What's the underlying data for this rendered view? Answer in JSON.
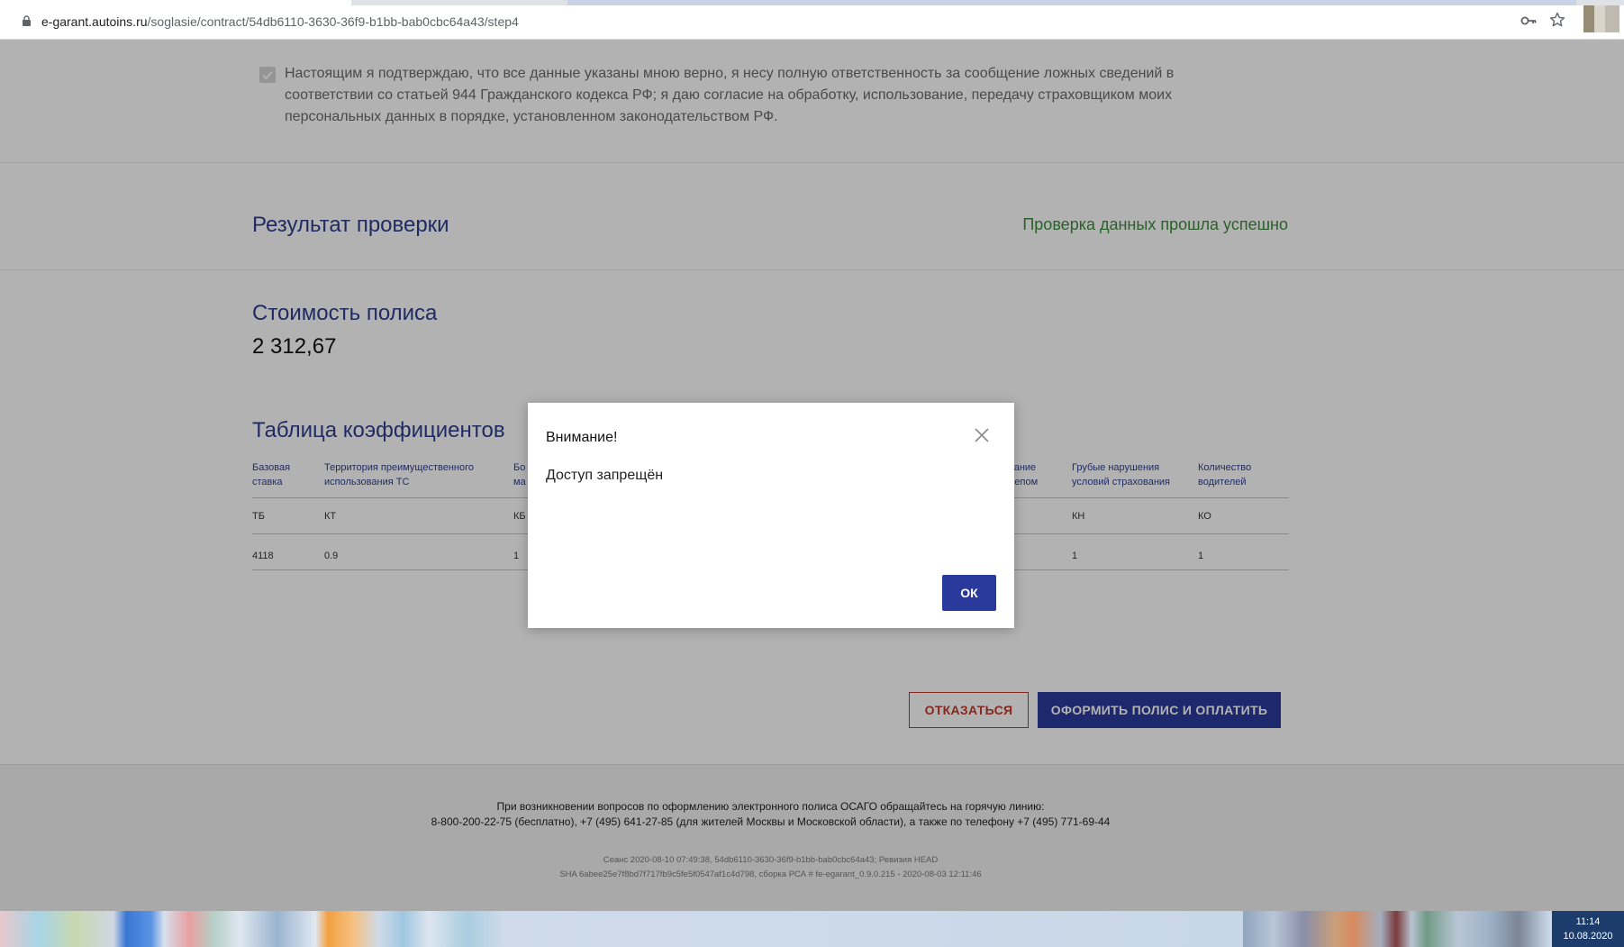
{
  "browser": {
    "url_host": "e-garant.autoins.ru",
    "url_path": "/soglasie/contract/54db6110-3630-36f9-b1bb-bab0cbc64a43/step4",
    "icons": [
      "lock-icon",
      "key-icon",
      "star-icon"
    ]
  },
  "consent": {
    "checked": true,
    "text": "Настоящим я подтверждаю, что все данные указаны мною верно, я несу полную ответственность за сообщение ложных сведений в соответствии со статьей 944 Гражданского кодекса РФ; я даю согласие на обработку, использование, передачу страховщиком моих персональных данных в порядке, установленном законодательством РФ."
  },
  "result": {
    "title": "Результат проверки",
    "status": "Проверка данных прошла успешно"
  },
  "policy": {
    "title": "Стоимость полиса",
    "price": "2 312,67"
  },
  "coefficients": {
    "title": "Таблица коэффициентов",
    "columns": [
      {
        "label": "Базовая ставка",
        "code": "ТБ",
        "value": "4118"
      },
      {
        "label": "Территория преимущественного использования ТС",
        "code": "КТ",
        "value": "0.9"
      },
      {
        "label": "Бо ма",
        "code": "КБ",
        "value": "1"
      },
      {
        "label": "вание лепом",
        "code": "",
        "value": ""
      },
      {
        "label": "Грубые нарушения условий страхования",
        "code": "КН",
        "value": "1"
      },
      {
        "label": "Количество водителей",
        "code": "КО",
        "value": "1"
      }
    ]
  },
  "actions": {
    "refuse_label": "ОТКАЗАТЬСЯ",
    "pay_label": "ОФОРМИТЬ ПОЛИС И ОПЛАТИТЬ"
  },
  "footer": {
    "help_line1": "При возникновении вопросов по оформлению электронного полиса ОСАГО обращайтесь на горячую линию:",
    "help_line2": "8-800-200-22-75 (бесплатно), +7 (495) 641-27-85 (для жителей Москвы и Московской области), а также по телефону +7 (495) 771-69-44",
    "meta_line1": "Сеанс 2020-08-10 07:49:38, 54db6110-3630-36f9-b1bb-bab0cbc64a43; Ревизия HEAD",
    "meta_line2": "SHA 6abee25e7f8bd7f717fb9c5fe5f0547af1c4d798, сборка РСА # fe-egarant_0.9.0.215 - 2020-08-03 12:11:46"
  },
  "modal": {
    "title": "Внимание!",
    "message": "Доступ запрещён",
    "ok_label": "ОК"
  },
  "taskbar": {
    "time": "11:14",
    "date": "10.08.2020"
  },
  "colors": {
    "accent": "#2a3a9c",
    "title": "#2f3e8f",
    "success": "#3d8c3d",
    "danger": "#c0392b"
  }
}
